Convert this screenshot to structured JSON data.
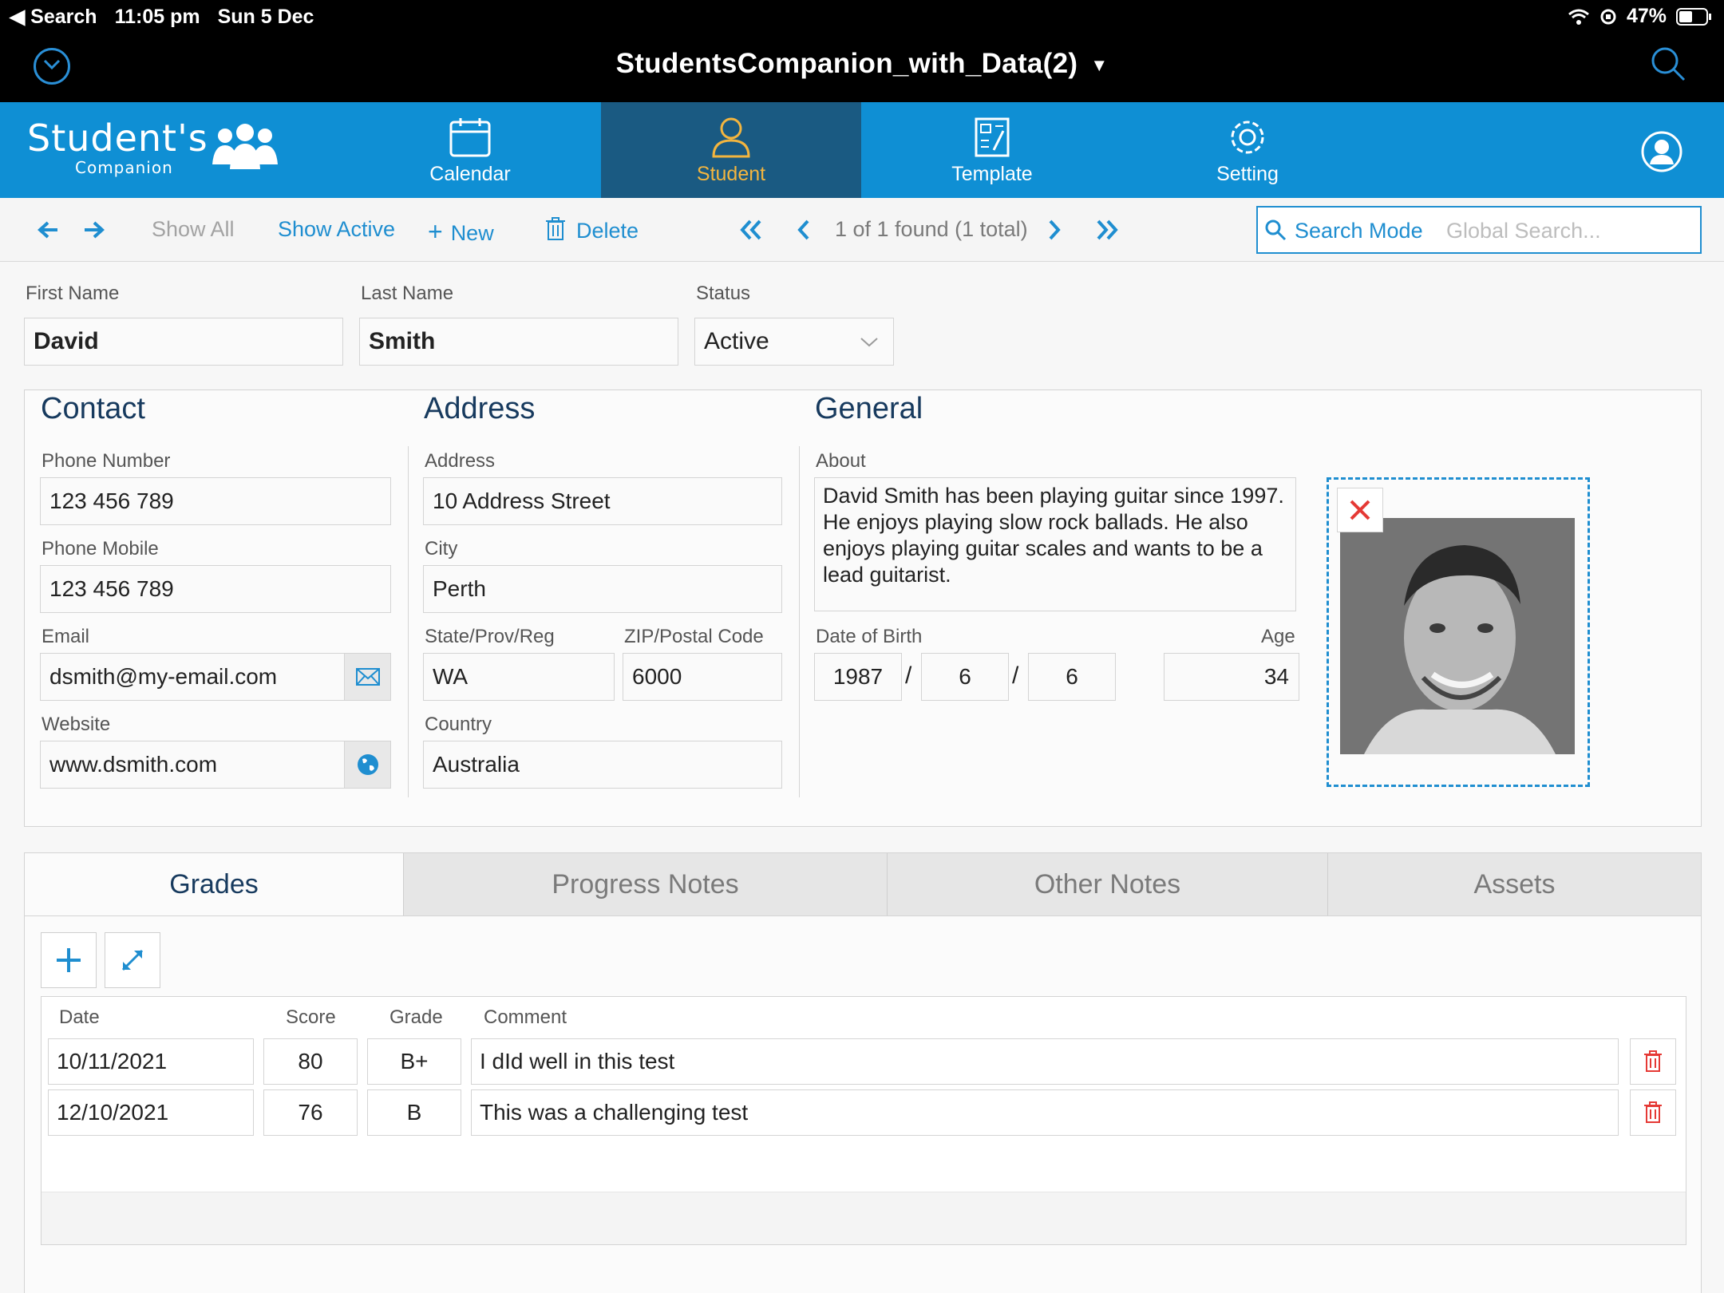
{
  "status_bar": {
    "back_label": "◀ Search",
    "time": "11:05 pm",
    "date": "Sun 5 Dec",
    "battery": "47%"
  },
  "title_bar": {
    "title": "StudentsCompanion_with_Data(2)"
  },
  "app_nav": {
    "logo_line1": "Student's",
    "logo_line2": "Companion",
    "tabs": [
      {
        "label": "Calendar",
        "icon": "calendar-icon"
      },
      {
        "label": "Student",
        "icon": "person-icon"
      },
      {
        "label": "Template",
        "icon": "template-icon"
      },
      {
        "label": "Setting",
        "icon": "gear-icon"
      }
    ]
  },
  "toolbar": {
    "show_all": "Show All",
    "show_active": "Show Active",
    "new": "New",
    "delete": "Delete",
    "record_info": "1 of 1 found (1 total)",
    "search_mode": "Search Mode",
    "search_placeholder": "Global Search..."
  },
  "header_fields": {
    "first_name_label": "First Name",
    "first_name": "David",
    "last_name_label": "Last Name",
    "last_name": "Smith",
    "status_label": "Status",
    "status": "Active"
  },
  "contact": {
    "title": "Contact",
    "phone_label": "Phone Number",
    "phone": "123 456 789",
    "mobile_label": "Phone Mobile",
    "mobile": "123 456 789",
    "email_label": "Email",
    "email": "dsmith@my-email.com",
    "website_label": "Website",
    "website": "www.dsmith.com"
  },
  "address": {
    "title": "Address",
    "address_label": "Address",
    "address": "10 Address Street",
    "city_label": "City",
    "city": "Perth",
    "state_label": "State/Prov/Reg",
    "state": "WA",
    "zip_label": "ZIP/Postal Code",
    "zip": "6000",
    "country_label": "Country",
    "country": "Australia"
  },
  "general": {
    "title": "General",
    "about_label": "About",
    "about": "David Smith has been playing guitar since 1997. He enjoys playing slow rock ballads. He also enjoys playing guitar scales and wants to be a lead guitarist.",
    "dob_label": "Date of Birth",
    "dob_year": "1987",
    "dob_month": "6",
    "dob_day": "6",
    "sep": "/",
    "age_label": "Age",
    "age": "34"
  },
  "tabs": [
    "Grades",
    "Progress Notes",
    "Other Notes",
    "Assets"
  ],
  "grades": {
    "columns": [
      "Date",
      "Score",
      "Grade",
      "Comment"
    ],
    "rows": [
      {
        "date": "10/11/2021",
        "score": "80",
        "grade": "B+",
        "comment": "I dId well in this test"
      },
      {
        "date": "12/10/2021",
        "score": "76",
        "grade": "B",
        "comment": "This was a challenging test"
      }
    ]
  },
  "colors": {
    "accent": "#0f8fd4",
    "active_tab": "#1a5a82",
    "active_tab_text": "#f3b53f",
    "delete_red": "#e53935"
  }
}
